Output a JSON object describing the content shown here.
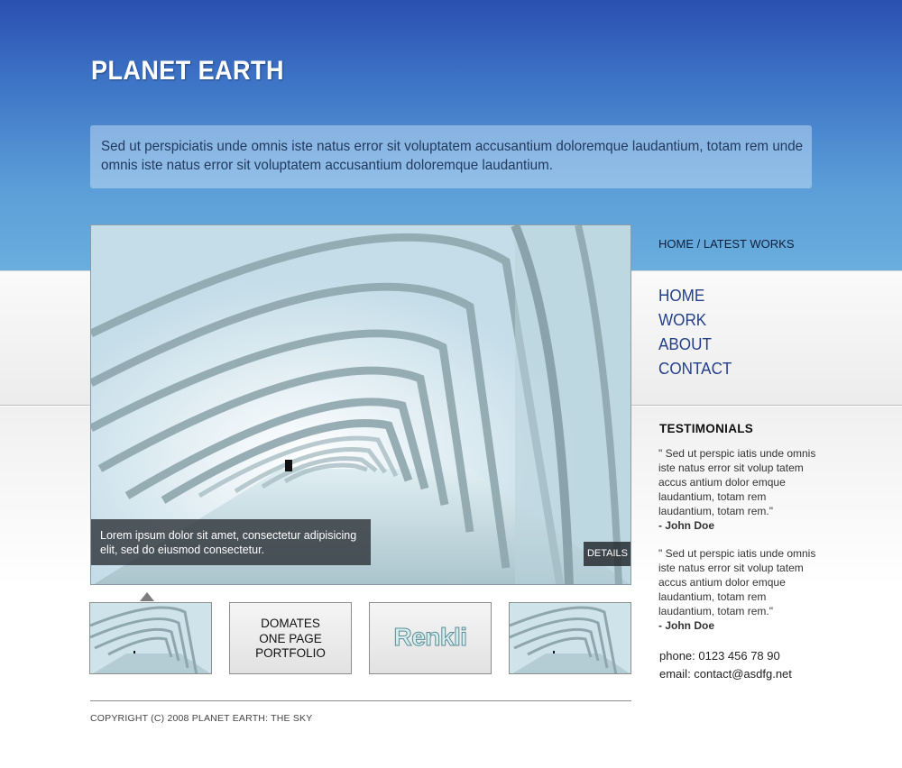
{
  "header": {
    "site_title": "PLANET EARTH",
    "intro_text": "Sed ut perspiciatis unde omnis iste natus error sit voluptatem accusantium doloremque laudantium, totam rem unde omnis iste natus error sit voluptatem accusantium doloremque laudantium."
  },
  "hero": {
    "caption": "Lorem ipsum dolor sit amet, consectetur adipisicing elit, sed do eiusmod consectetur.",
    "details_label": "DETAILS"
  },
  "thumbnails": [
    {
      "type": "image",
      "icon": "arch-corridor-thumbnail"
    },
    {
      "type": "text",
      "lines": [
        "DOMATES",
        "ONE PAGE",
        "PORTFOLIO"
      ]
    },
    {
      "type": "logo",
      "text": "Renkli"
    },
    {
      "type": "image",
      "icon": "arch-corridor-thumbnail"
    }
  ],
  "sidebar": {
    "breadcrumb": "HOME / LATEST WORKS",
    "nav": [
      "HOME",
      "WORK",
      "ABOUT",
      "CONTACT"
    ],
    "testimonials_title": "TESTIMONIALS",
    "testimonials": [
      {
        "quote": "\" Sed ut perspic iatis unde omnis iste natus error sit volup tatem accus antium dolor emque laudantium, totam rem laudantium, totam rem.\"",
        "author": "- John Doe"
      },
      {
        "quote": "\" Sed ut perspic iatis unde omnis iste natus error sit volup tatem accus antium dolor emque laudantium, totam rem laudantium, totam rem.\"",
        "author": "- John Doe"
      }
    ],
    "phone": "phone: 0123 456 78 90",
    "email": "email: contact@asdfg.net"
  },
  "footer": {
    "copyright": "COPYRIGHT (C) 2008 PLANET EARTH: THE SKY"
  },
  "colors": {
    "header_blue": "#2a4fb0",
    "sky_blue": "#6aaede",
    "nav_blue": "#233f8c"
  }
}
